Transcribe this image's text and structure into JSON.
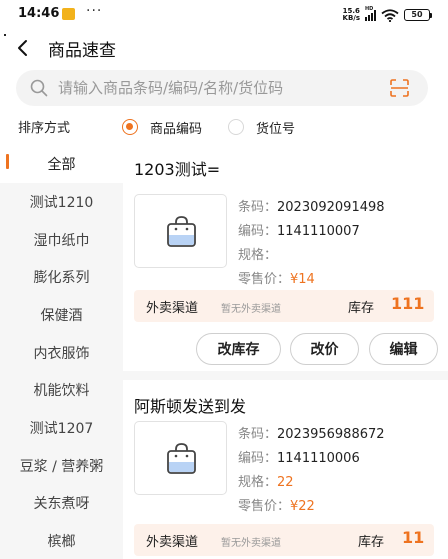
{
  "status_bar": {
    "time": "14:46",
    "dots": "···",
    "net_speed_top": "15.6",
    "net_speed_bottom": "KB/s",
    "network_badge": "HD",
    "battery": "50"
  },
  "header": {
    "title": "商品速查",
    "back_icon": "chevron-left-icon"
  },
  "search": {
    "placeholder": "请输入商品条码/编码/名称/货位码",
    "value": "",
    "scan_icon": "scan-icon"
  },
  "sort": {
    "label": "排序方式",
    "options": [
      {
        "label": "商品编码",
        "selected": true
      },
      {
        "label": "货位号",
        "selected": false
      }
    ]
  },
  "sidebar": {
    "items": [
      {
        "label": "全部",
        "active": true
      },
      {
        "label": "测试1210"
      },
      {
        "label": "湿巾纸巾"
      },
      {
        "label": "膨化系列"
      },
      {
        "label": "保健酒"
      },
      {
        "label": "内衣服饰"
      },
      {
        "label": "机能饮料"
      },
      {
        "label": "测试1207"
      },
      {
        "label": "豆浆 / 营养粥"
      },
      {
        "label": "关东煮呀"
      },
      {
        "label": "槟榔"
      }
    ]
  },
  "products": [
    {
      "name": "1203测试=",
      "barcode_label": "条码：",
      "barcode": "2023092091498",
      "code_label": "编码：",
      "code": "1141110007",
      "spec_label": "规格：",
      "spec": "",
      "price_label": "零售价：",
      "price": "¥14",
      "channel_label": "外卖渠道",
      "channel_status": "暂无外卖渠道",
      "stock_label": "库存",
      "stock": "111",
      "buttons": [
        "改库存",
        "改价",
        "编辑"
      ]
    },
    {
      "name": "阿斯顿发送到发",
      "barcode_label": "条码：",
      "barcode": "2023956988672",
      "code_label": "编码：",
      "code": "1141110006",
      "spec_label": "规格：",
      "spec": "22",
      "price_label": "零售价：",
      "price": "¥22",
      "channel_label": "外卖渠道",
      "channel_status": "暂无外卖渠道",
      "stock_label": "库存",
      "stock": "11"
    }
  ],
  "colors": {
    "accent": "#ee7320",
    "channel_bg": "#fdf1ea",
    "sidebar_bg": "#f6f6f6",
    "search_bg": "#f3f3f3"
  },
  "icons": {
    "product_placeholder": "shopping-bag-icon"
  }
}
